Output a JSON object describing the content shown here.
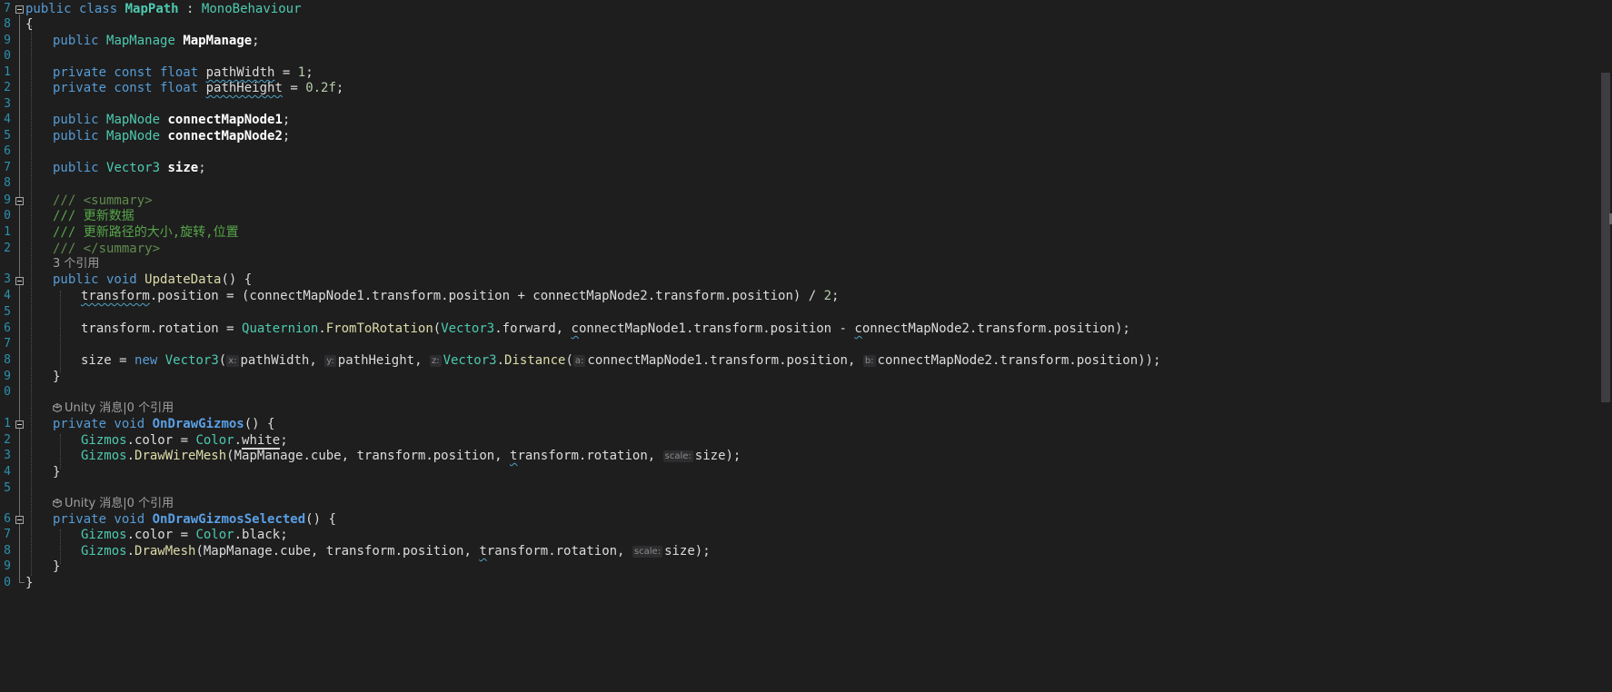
{
  "editor": {
    "line_numbers": [
      "7",
      "8",
      "9",
      "0",
      "1",
      "2",
      "3",
      "4",
      "5",
      "6",
      "7",
      "8",
      "9",
      "0",
      "1",
      "2",
      "3",
      "4",
      "5",
      "6",
      "7",
      "8",
      "9",
      "0",
      "1",
      "2",
      "3",
      "4",
      "5",
      "6",
      "7",
      "8",
      "9",
      "0"
    ],
    "class_decl": {
      "public": "public",
      "class": "class",
      "name": "MapPath",
      "colon": " : ",
      "base": "MonoBehaviour"
    },
    "open_brace": "{",
    "close_brace": "}",
    "field_mapmanage": {
      "public": "public",
      "type": "MapManage",
      "name": "MapManage",
      "semi": ";"
    },
    "field_width": {
      "mods": "private const float",
      "name": "pathWidth",
      "rest": " = ",
      "value": "1",
      "semi": ";"
    },
    "field_height": {
      "mods": "private const float",
      "name": "pathHeight",
      "rest": " = ",
      "value": "0.2f",
      "semi": ";"
    },
    "field_node1": {
      "public": "public",
      "type": "MapNode",
      "name": "connectMapNode1",
      "semi": ";"
    },
    "field_node2": {
      "public": "public",
      "type": "MapNode",
      "name": "connectMapNode2",
      "semi": ";"
    },
    "field_size": {
      "public": "public",
      "type": "Vector3",
      "name": "size",
      "semi": ";"
    },
    "doc_summary_open": "/// <summary>",
    "doc_line1": "/// 更新数据",
    "doc_line2": "/// 更新路径的大小,旋转,位置",
    "doc_summary_close": "/// </summary>",
    "codelens_update": "3 个引用",
    "update_sig": {
      "mods": "public void",
      "name": "UpdateData",
      "rest": "() {"
    },
    "update_pos": {
      "a": "transform",
      "b": ".position = (connectMapNode1.transform.position + connectMapNode2.transform.position) / ",
      "num": "2",
      "semi": ";"
    },
    "update_rot": {
      "lead": "transform.rotation = ",
      "type1": "Quaternion",
      "dot1": ".",
      "method": "FromToRotation",
      "p1": "(",
      "type2": "Vector3",
      "rest1": ".forward, ",
      "squig": "c",
      "rest2": "onnectMapNode1.transform.position - ",
      "squig2": "c",
      "rest3": "onnectMapNode2.transform.position);"
    },
    "update_size": {
      "lead": "size = ",
      "new": "new",
      "sp": " ",
      "type": "Vector3",
      "p1": "(",
      "hint_x": "x:",
      "arg1": "pathWidth, ",
      "hint_y": "y:",
      "arg2": "pathHeight, ",
      "hint_z": "z:",
      "type2": "Vector3",
      "dot": ".",
      "method": "Distance",
      "p2": "(",
      "hint_a": "a:",
      "arg3": "connectMapNode1.transform.position, ",
      "hint_b": "b:",
      "arg4": "connectMapNode2.transform.position));"
    },
    "codelens_gizmos": "Unity 消息|0 个引用",
    "gizmos_sig": {
      "mods": "private void",
      "name": "OnDrawGizmos",
      "rest": "() {"
    },
    "gizmos_color": {
      "type": "Gizmos",
      "rest": ".color = ",
      "type2": "Color",
      "dot": ".",
      "value": "white",
      "semi": ";"
    },
    "gizmos_draw": {
      "type": "Gizmos",
      "dot": ".",
      "method": "DrawWireMesh",
      "rest": "(MapManage.cube, transform.position, ",
      "squig": "t",
      "rest2": "ransform.rotation, ",
      "hint": "scale:",
      "rest3": "size);"
    },
    "codelens_selected": "Unity 消息|0 个引用",
    "selected_sig": {
      "mods": "private void",
      "name": "OnDrawGizmosSelected",
      "rest": "() {"
    },
    "selected_color": {
      "type": "Gizmos",
      "rest": ".color = ",
      "type2": "Color",
      "dot": ".",
      "value": "black",
      "semi": ";"
    },
    "selected_draw": {
      "type": "Gizmos",
      "dot": ".",
      "method": "DrawMesh",
      "rest": "(MapManage.cube, transform.position, ",
      "squig": "t",
      "rest2": "ransform.rotation, ",
      "hint": "scale:",
      "rest3": "size);"
    },
    "colors": {
      "background": "#1e1e1e",
      "keyword": "#569cd6",
      "type": "#4ec9b0",
      "method": "#dcdcaa",
      "comment": "#57a64a",
      "line_number": "#2b91af"
    }
  }
}
